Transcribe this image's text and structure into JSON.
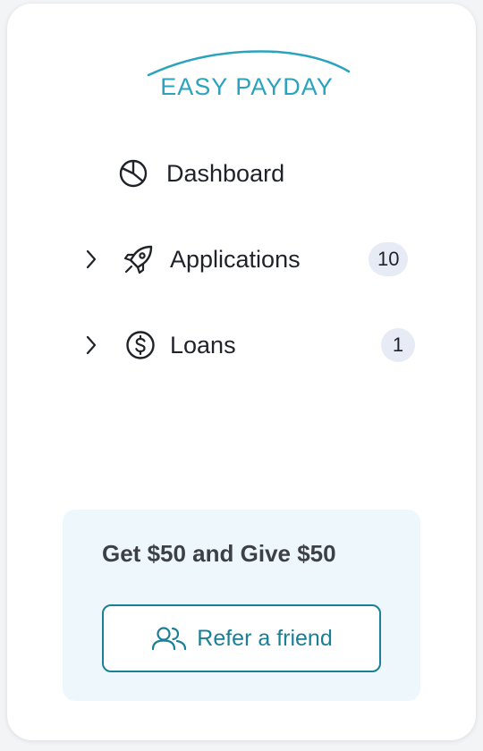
{
  "brand": {
    "name": "EASY PAYDAY",
    "color": "#2aa3be",
    "logo_icon": "swoosh-arc"
  },
  "nav": {
    "items": [
      {
        "label": "Dashboard",
        "icon": "pie-chart-icon",
        "expandable": false,
        "badge": null
      },
      {
        "label": "Applications",
        "icon": "rocket-icon",
        "expandable": true,
        "badge": "10"
      },
      {
        "label": "Loans",
        "icon": "dollar-circle-icon",
        "expandable": true,
        "badge": "1"
      }
    ]
  },
  "promo": {
    "title": "Get $50 and Give $50",
    "button_label": "Refer a friend",
    "button_icon": "users-icon",
    "background": "#eef7fc",
    "accent": "#1b7f97"
  }
}
